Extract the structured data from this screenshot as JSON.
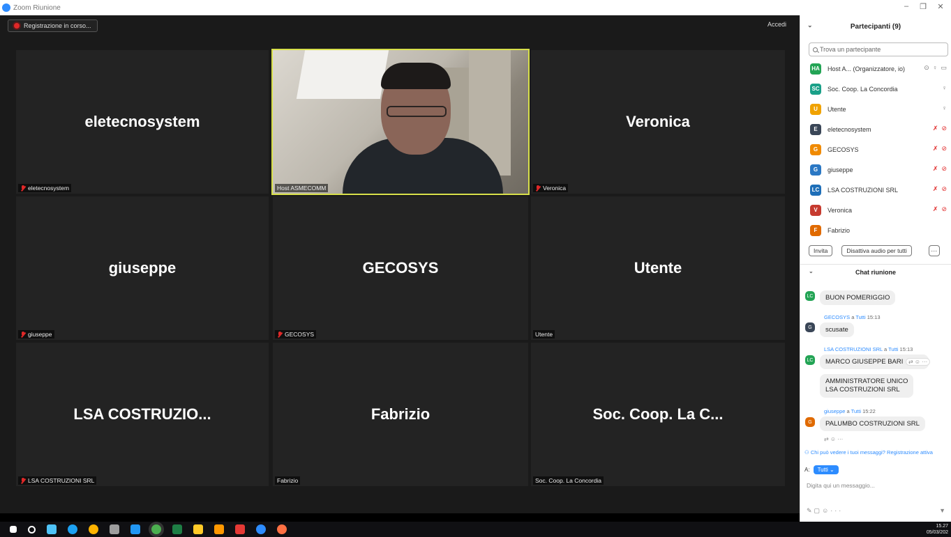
{
  "window": {
    "title": "Zoom Riunione",
    "minimize": "–",
    "restore": "❐",
    "close": "✕"
  },
  "toolbar": {
    "recording_label": "Registrazione in corso...",
    "accedi_label": "Accedi"
  },
  "tiles": [
    {
      "display": "eletecnosystem",
      "label": "eletecnosystem",
      "muted": true
    },
    {
      "display": "",
      "label": "Host ASMECOMM",
      "muted": false,
      "video": true
    },
    {
      "display": "Veronica",
      "label": "Veronica",
      "muted": true
    },
    {
      "display": "giuseppe",
      "label": "giuseppe",
      "muted": true
    },
    {
      "display": "GECOSYS",
      "label": "GECOSYS",
      "muted": true
    },
    {
      "display": "Utente",
      "label": "Utente",
      "muted": false
    },
    {
      "display": "LSA  COSTRUZIO...",
      "label": "LSA COSTRUZIONI SRL",
      "muted": true
    },
    {
      "display": "Fabrizio",
      "label": "Fabrizio",
      "muted": false
    },
    {
      "display": "Soc. Coop. La C...",
      "label": "Soc. Coop. La Concordia",
      "muted": false
    }
  ],
  "participants_panel": {
    "title": "Partecipanti (9)",
    "search_placeholder": "Trova un partecipante",
    "items": [
      {
        "initials": "HA",
        "name": "Host A...  (Organizzatore, io)",
        "color": "#23a455",
        "icons": "host"
      },
      {
        "initials": "SC",
        "name": "Soc. Coop. La Concordia",
        "color": "#1aa088",
        "icons": "mic"
      },
      {
        "initials": "U",
        "name": "Utente",
        "color": "#f0a200",
        "icons": "mic"
      },
      {
        "initials": "E",
        "name": "eletecnosystem",
        "color": "#3a4657",
        "icons": "muted"
      },
      {
        "initials": "G",
        "name": "GECOSYS",
        "color": "#f08a00",
        "icons": "muted"
      },
      {
        "initials": "G",
        "name": "giuseppe",
        "color": "#2b78c4",
        "icons": "muted"
      },
      {
        "initials": "LC",
        "name": "LSA COSTRUZIONI SRL",
        "color": "#1f6fb8",
        "icons": "muted"
      },
      {
        "initials": "V",
        "name": "Veronica",
        "color": "#c63b2f",
        "icons": "muted"
      },
      {
        "initials": "F",
        "name": "Fabrizio",
        "color": "#e06a00",
        "icons": "none"
      }
    ],
    "invite_label": "Invita",
    "mute_all_label": "Disattiva audio per tutti",
    "more_label": "···"
  },
  "chat": {
    "title": "Chat riunione",
    "to_label": "A:",
    "to_value": "Tutti ⌄",
    "input_placeholder": "Digita qui un messaggio...",
    "privacy_note": "Chi può vedere i tuoi messaggi? Registrazione attiva",
    "messages": [
      {
        "avatar": "LC",
        "avatar_color": "#23a455",
        "sender": "",
        "to": "",
        "time": "",
        "text": "BUON POMERIGGIO"
      },
      {
        "avatar": "G",
        "avatar_color": "#3a4657",
        "sender": "GECOSYS",
        "to": "Tutti",
        "time": "15:13",
        "text": "scusate"
      },
      {
        "avatar": "LC",
        "avatar_color": "#23a455",
        "sender": "LSA COSTRUZIONI SRL",
        "to": "Tutti",
        "time": "15:13",
        "text": "MARCO GIUSEPPE BARI",
        "text2": "AMMINISTRATORE UNICO\nLSA COSTRUZIONI SRL"
      },
      {
        "avatar": "G",
        "avatar_color": "#e06a00",
        "sender": "giuseppe",
        "to": "Tutti",
        "time": "15:22",
        "text": "PALUMBO COSTRUZIONI SRL"
      }
    ],
    "joiner": "a"
  },
  "taskbar": {
    "time": "15.27",
    "date": "05/03/202"
  }
}
